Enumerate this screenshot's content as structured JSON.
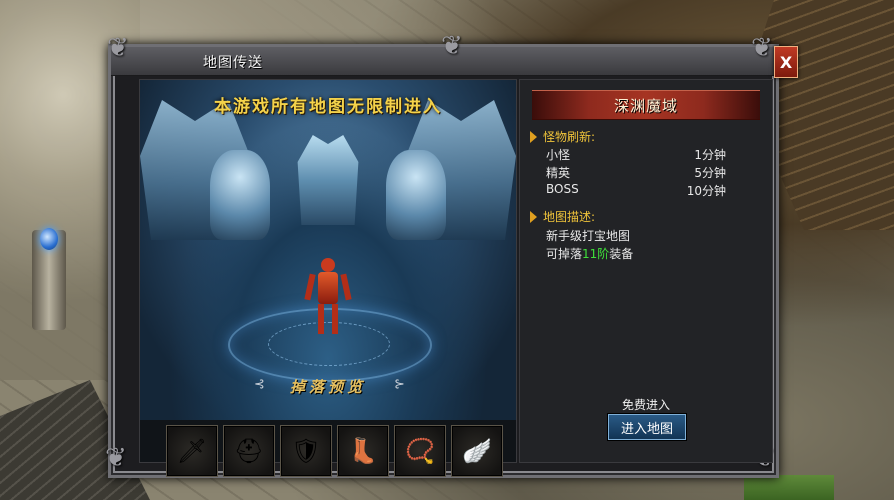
{
  "dialog": {
    "title": "地图传送",
    "close_label": "X"
  },
  "map_preview": {
    "banner": "本游戏所有地图无限制进入",
    "drops_title": "掉落预览",
    "drops_deco_left": "⊰",
    "drops_deco_right": "⊱",
    "drop_items": [
      {
        "icon": "sword-icon",
        "glyph": "🗡"
      },
      {
        "icon": "helmet-icon",
        "glyph": "⛑"
      },
      {
        "icon": "armor-icon",
        "glyph": "🛡"
      },
      {
        "icon": "boots-icon",
        "glyph": "👢"
      },
      {
        "icon": "necklace-icon",
        "glyph": "📿"
      },
      {
        "icon": "wings-icon",
        "glyph": "🪽"
      }
    ]
  },
  "info": {
    "map_name": "深渊魔域",
    "monster_section_title": "怪物刷新:",
    "monsters": [
      {
        "name": "小怪",
        "time": "1分钟"
      },
      {
        "name": "精英",
        "time": "5分钟"
      },
      {
        "name": "BOSS",
        "time": "10分钟"
      }
    ],
    "desc_section_title": "地图描述:",
    "desc_line1": "新手级打宝地图",
    "desc_line2_prefix": "可掉落",
    "desc_line2_highlight": "11阶",
    "desc_line2_suffix": "装备",
    "free_label": "免费进入",
    "enter_button": "进入地图"
  },
  "colors": {
    "highlight_green": "#3fe03a",
    "gold_text": "#f0c43a",
    "title_bar_red": "#a63422"
  }
}
